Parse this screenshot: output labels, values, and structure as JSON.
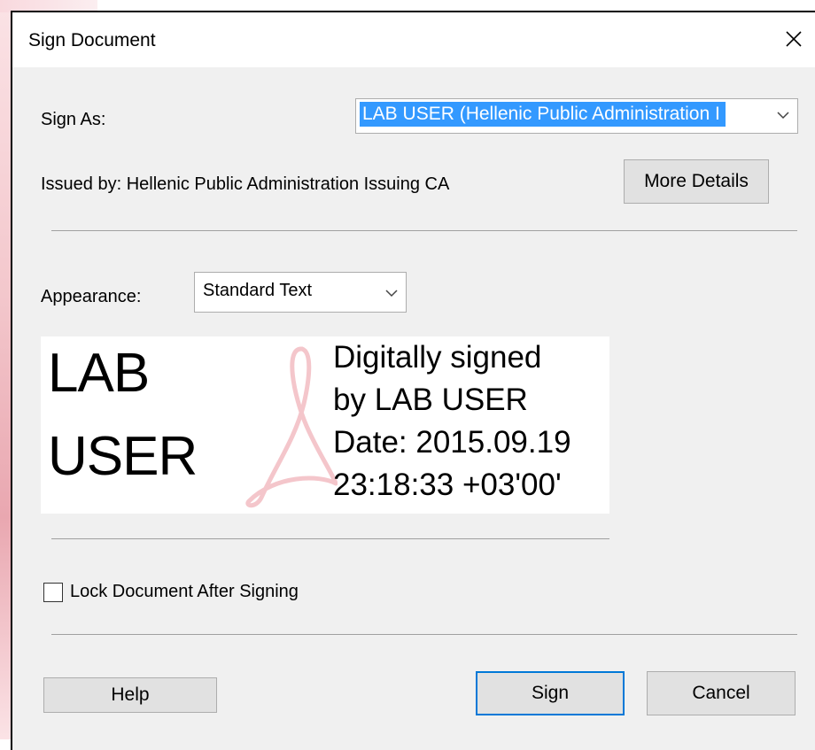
{
  "dialog": {
    "title": "Sign Document"
  },
  "sign_as": {
    "label": "Sign As:",
    "selected": "LAB USER (Hellenic Public Administration I"
  },
  "issuer": {
    "text": "Issued by: Hellenic Public Administration Issuing CA",
    "more_details_label": "More Details"
  },
  "appearance": {
    "label": "Appearance:",
    "selected": "Standard Text"
  },
  "preview": {
    "name_lines": [
      "LAB",
      "USER"
    ],
    "detail_lines": [
      "Digitally signed",
      "by LAB USER",
      "Date: 2015.09.19",
      "23:18:33 +03'00'"
    ]
  },
  "lock": {
    "label": "Lock Document After Signing",
    "checked": false
  },
  "buttons": {
    "help": "Help",
    "sign": "Sign",
    "cancel": "Cancel"
  },
  "icons": {
    "close": "close-icon",
    "dropdown": "chevron-down-icon",
    "watermark": "acrobat-logo-icon"
  },
  "colors": {
    "selection": "#3399ff",
    "default_button_border": "#0078d7",
    "watermark": "#f4c6cb"
  }
}
